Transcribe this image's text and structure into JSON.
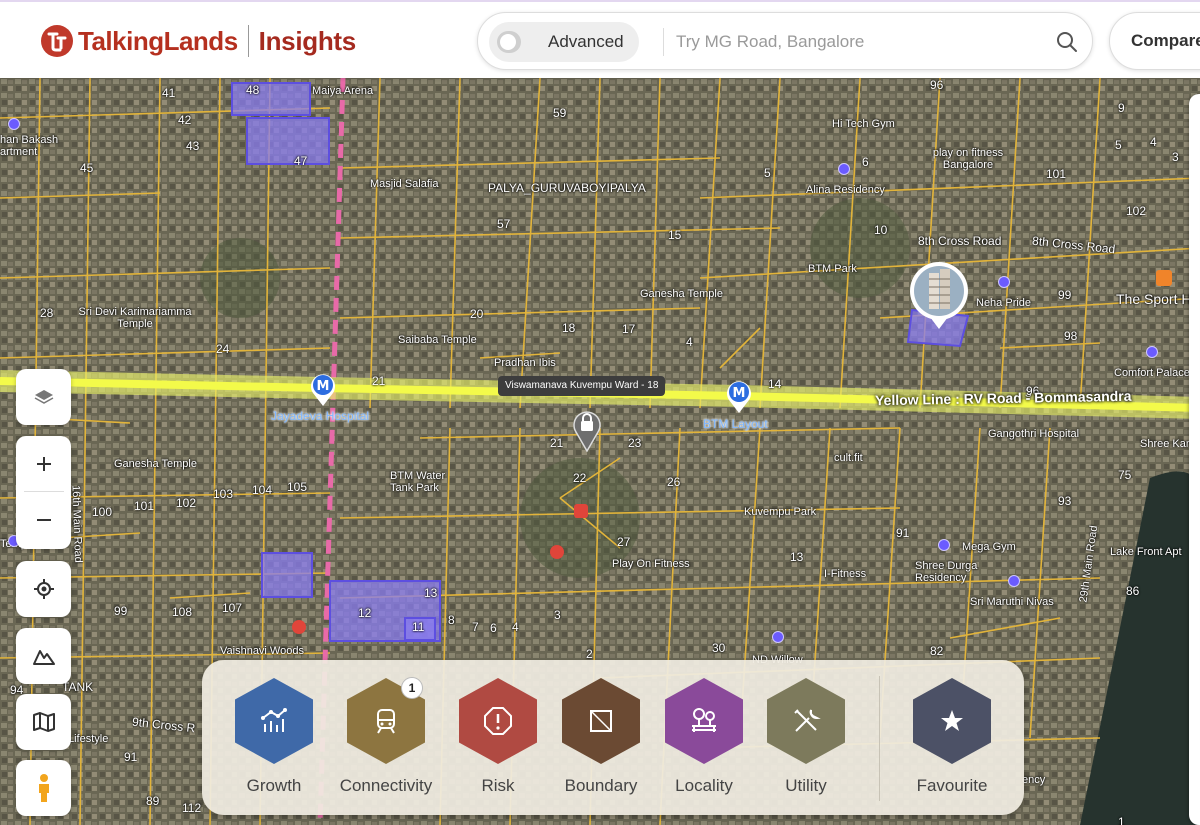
{
  "header": {
    "brand": "TalkingLands",
    "brand_sub": "Insights",
    "advanced_label": "Advanced",
    "search_placeholder": "Try MG Road, Bangalore",
    "compare_label": "Compare"
  },
  "map": {
    "ward_label": "Viswamanava Kuvempu Ward - 18",
    "yellow_line_label": "Yellow Line : RV Road - Bommasandra",
    "metro_stations": [
      "Jayadeva Hospital",
      "BTM Layout"
    ],
    "places": [
      "Masjid Salafia",
      "PALYA_GURUVABOYIPALYA",
      "Maiya Arena",
      "Hi Tech Gym",
      "play on fitness Bangalore",
      "Alina Residency",
      "8th Cross Road",
      "8th Cross Road",
      "BTM Park",
      "Neha Pride",
      "The Sport H",
      "Comfort Palace",
      "Ganesha Temple",
      "Sri Devi Karimariamma Temple",
      "Saibaba Temple",
      "Pradhan Ibis",
      "Gangothri Hospital",
      "Shree Kar",
      "Ganesha Temple",
      "BTM Water Tank Park",
      "cult.fit",
      "Kuvempu Park",
      "Play On Fitness",
      "I-Fitness",
      "Mega Gym",
      "Shree Durga Residency",
      "Sri Maruthi Nivas",
      "Lake Front Apt",
      "Vaishnavi Woods",
      "TANK",
      "9th Cross R",
      "Lifestyle",
      "ND Willow",
      "29th Main Road",
      "16th Main Road",
      "han Bakash artment",
      "Temp",
      "ency"
    ],
    "plot_numbers": [
      "48",
      "41",
      "42",
      "43",
      "45",
      "47",
      "59",
      "57",
      "15",
      "5",
      "6",
      "96",
      "9",
      "5",
      "4",
      "3",
      "101",
      "102",
      "10",
      "99",
      "98",
      "28",
      "24",
      "20",
      "18",
      "17",
      "4",
      "3",
      "21",
      "14",
      "96",
      "21",
      "22",
      "23",
      "26",
      "75",
      "93",
      "100",
      "101",
      "102",
      "103",
      "104",
      "105",
      "27",
      "13",
      "91",
      "86",
      "99",
      "108",
      "107",
      "12",
      "13",
      "11",
      "8",
      "7",
      "6",
      "4",
      "3",
      "2",
      "30",
      "82",
      "94",
      "91",
      "89",
      "112",
      "1"
    ]
  },
  "controls": [
    "layers-button",
    "zoom-in-button",
    "zoom-out-button",
    "locate-button",
    "terrain-button",
    "map-style-button",
    "street-view-button"
  ],
  "categories": [
    {
      "label": "Growth",
      "color": "#3f69a8"
    },
    {
      "label": "Connectivity",
      "color": "#8d7540",
      "badge": "1"
    },
    {
      "label": "Risk",
      "color": "#b04a42"
    },
    {
      "label": "Boundary",
      "color": "#6b4a33"
    },
    {
      "label": "Locality",
      "color": "#8a4a9a"
    },
    {
      "label": "Utility",
      "color": "#7d7a5c"
    },
    {
      "label": "Favourite",
      "color": "#4c5166"
    }
  ]
}
